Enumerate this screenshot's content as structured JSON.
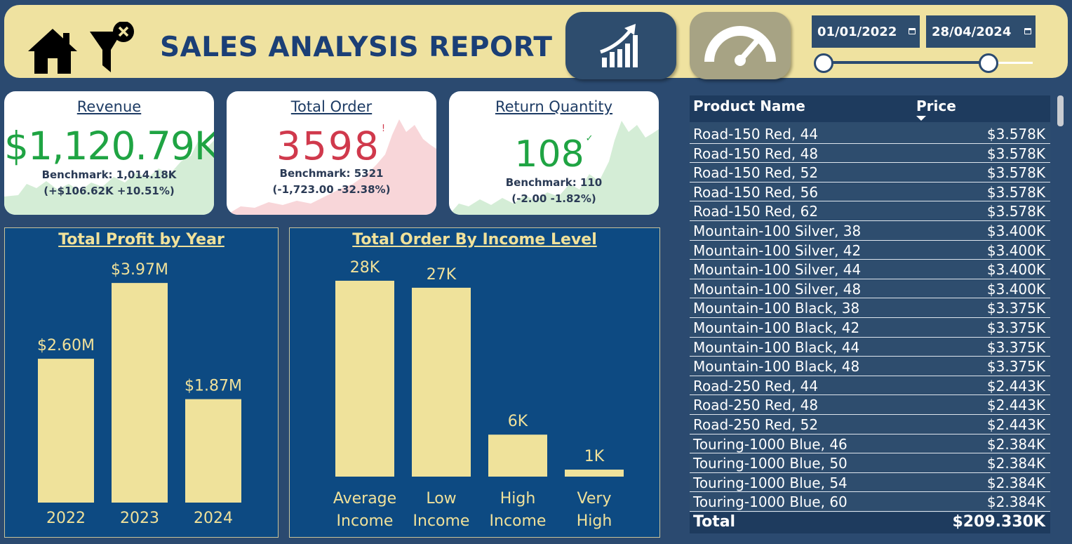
{
  "header": {
    "title": "SALES ANALYSIS REPORT",
    "date_from": "01/01/2022",
    "date_to": "28/04/2024"
  },
  "kpis": [
    {
      "title": "Revenue",
      "value": "$1,120.79K",
      "mark": "✓",
      "benchmark": "Benchmark: 1,014.18K",
      "variance": "(+$106.62K +10.51%)",
      "color": "#1fa443",
      "spark_color": "#d4edd6"
    },
    {
      "title": "Total Order",
      "value": "3598",
      "mark": "!",
      "benchmark": "Benchmark: 5321",
      "variance": "(-1,723.00 -32.38%)",
      "color": "#d0394c",
      "spark_color": "#f8d6d9"
    },
    {
      "title": "Return Quantity",
      "value": "108",
      "mark": "✓",
      "benchmark": "Benchmark: 110",
      "variance": "(-2.00 -1.82%)",
      "color": "#1fa443",
      "spark_color": "#d4edd6"
    }
  ],
  "chart_data": [
    {
      "type": "bar",
      "title": "Total Profit by Year",
      "categories": [
        "2022",
        "2023",
        "2024"
      ],
      "values": [
        2.6,
        3.97,
        1.87
      ],
      "data_labels": [
        "$2.60M",
        "$3.97M",
        "$1.87M"
      ],
      "bar_color": "#efe29b",
      "ylim": [
        0,
        4.2
      ]
    },
    {
      "type": "bar",
      "title": "Total Order By Income Level",
      "categories": [
        [
          "Average",
          "Income"
        ],
        [
          "Low",
          "Income"
        ],
        [
          "High",
          "Income"
        ],
        [
          "Very",
          "High"
        ]
      ],
      "values": [
        28,
        27,
        6,
        1
      ],
      "data_labels": [
        "28K",
        "27K",
        "6K",
        "1K"
      ],
      "bar_color": "#efe29b",
      "ylim": [
        0,
        29.5
      ]
    }
  ],
  "table": {
    "columns": [
      "Product Name",
      "Price"
    ],
    "rows": [
      [
        "Road-150 Red, 44",
        "$3.578K"
      ],
      [
        "Road-150 Red, 48",
        "$3.578K"
      ],
      [
        "Road-150 Red, 52",
        "$3.578K"
      ],
      [
        "Road-150 Red, 56",
        "$3.578K"
      ],
      [
        "Road-150 Red, 62",
        "$3.578K"
      ],
      [
        "Mountain-100 Silver, 38",
        "$3.400K"
      ],
      [
        "Mountain-100 Silver, 42",
        "$3.400K"
      ],
      [
        "Mountain-100 Silver, 44",
        "$3.400K"
      ],
      [
        "Mountain-100 Silver, 48",
        "$3.400K"
      ],
      [
        "Mountain-100 Black, 38",
        "$3.375K"
      ],
      [
        "Mountain-100 Black, 42",
        "$3.375K"
      ],
      [
        "Mountain-100 Black, 44",
        "$3.375K"
      ],
      [
        "Mountain-100 Black, 48",
        "$3.375K"
      ],
      [
        "Road-250 Red, 44",
        "$2.443K"
      ],
      [
        "Road-250 Red, 48",
        "$2.443K"
      ],
      [
        "Road-250 Red, 52",
        "$2.443K"
      ],
      [
        "Touring-1000 Blue, 46",
        "$2.384K"
      ],
      [
        "Touring-1000 Blue, 50",
        "$2.384K"
      ],
      [
        "Touring-1000 Blue, 54",
        "$2.384K"
      ],
      [
        "Touring-1000 Blue, 60",
        "$2.384K"
      ]
    ],
    "total_label": "Total",
    "total_value": "$209.330K"
  }
}
